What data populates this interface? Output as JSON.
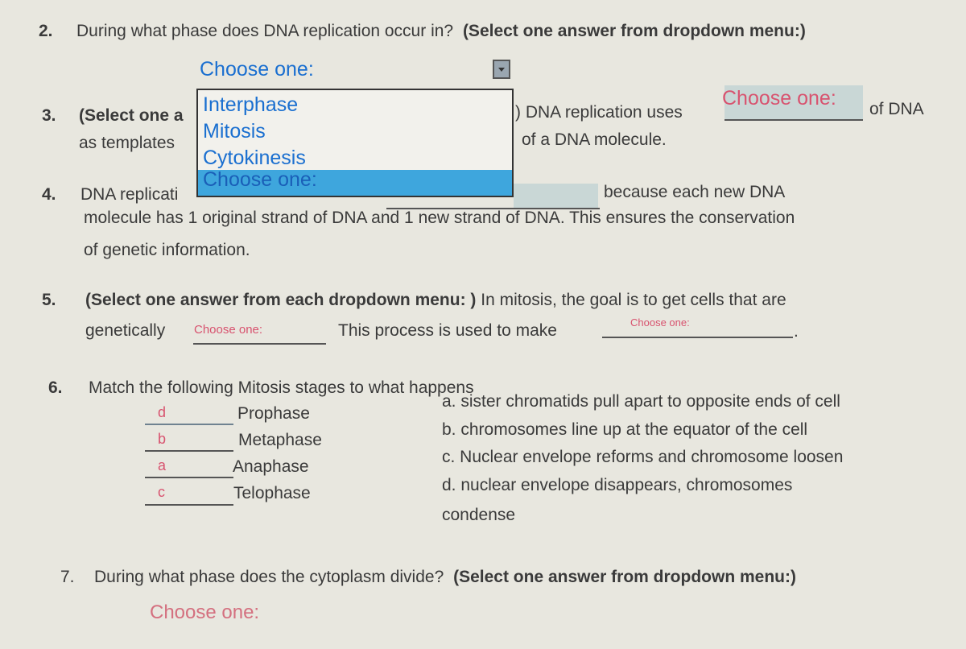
{
  "q2": {
    "number": "2.",
    "text": "During what phase does DNA replication occur in?",
    "instruction": "(Select one answer from dropdown menu:)",
    "select_value": "Choose one:",
    "options": [
      "Interphase",
      "Mitosis",
      "Cytokinesis",
      "Choose one:"
    ],
    "highlight_color": "#3ea6dd"
  },
  "q3": {
    "number": "3.",
    "text_a": "(Select one a",
    "text_b": ") DNA replication uses",
    "text_c": "of DNA",
    "text_d": "as templates",
    "text_e": "of a DNA molecule.",
    "select_value": "Choose one:"
  },
  "q4": {
    "number": "4.",
    "text_a": "DNA replicati",
    "text_b": "because each new DNA",
    "line2": "molecule has 1 original strand of DNA and 1 new strand of DNA.  This ensures the conservation",
    "line3": "of genetic information."
  },
  "q5": {
    "number": "5.",
    "instruction": "(Select one answer from each dropdown menu: )",
    "text_a": "In mitosis, the goal is to get cells that are",
    "text_b": "genetically",
    "select1_value": "Choose one:",
    "text_c": "This process is used to make",
    "select2_value": "Choose one:",
    "text_d": "."
  },
  "q6": {
    "number": "6.",
    "text": "Match the following Mitosis stages to what  happens",
    "stages": [
      {
        "answer": "d",
        "name": "Prophase"
      },
      {
        "answer": "b",
        "name": "Metaphase"
      },
      {
        "answer": "a",
        "name": "Anaphase"
      },
      {
        "answer": "c",
        "name": "Telophase"
      }
    ],
    "descriptions": [
      "a. sister chromatids pull apart to opposite ends of cell",
      "b. chromosomes line up at the equator of the cell",
      "c. Nuclear envelope reforms and chromosome loosen",
      "d. nuclear envelope disappears, chromosomes",
      "condense"
    ]
  },
  "q7": {
    "number": "7.",
    "text": "During what phase does the cytoplasm divide?",
    "instruction": "(Select one answer from dropdown menu:)",
    "select_value": "Choose one:"
  }
}
